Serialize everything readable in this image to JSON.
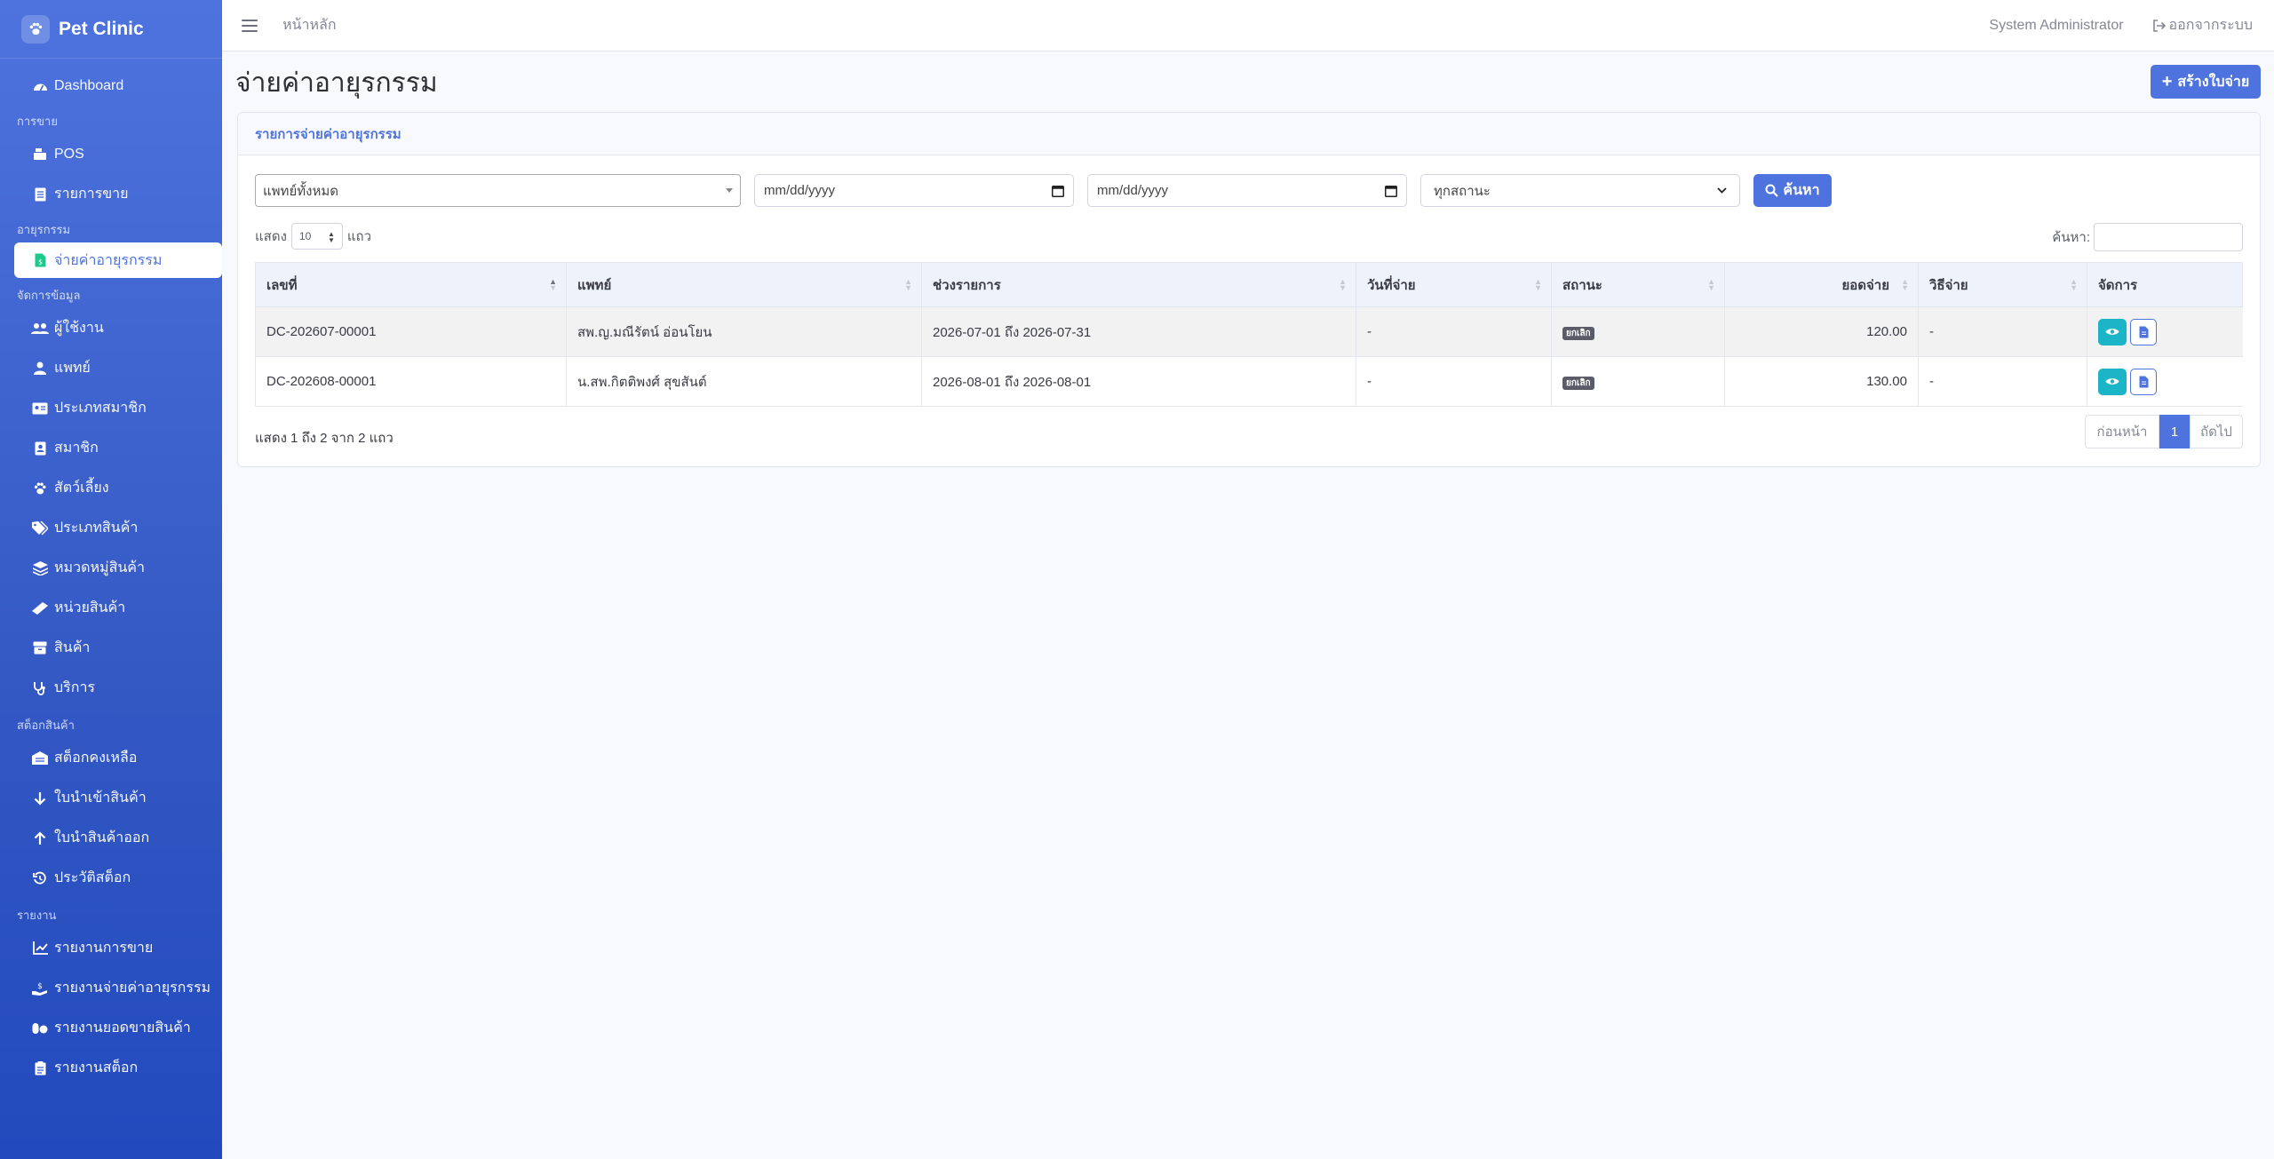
{
  "sidebar": {
    "brand": "Pet Clinic",
    "items": {
      "dashboard": "Dashboard",
      "sales_heading": "การขาย",
      "pos": "POS",
      "sales_list": "รายการขาย",
      "medicine_heading": "อายุรกรรม",
      "medicine_pay": "จ่ายค่าอายุรกรรม",
      "data_heading": "จัดการข้อมูล",
      "users": "ผู้ใช้งาน",
      "doctors": "แพทย์",
      "member_types": "ประเภทสมาชิก",
      "members": "สมาชิก",
      "pets": "สัตว์เลี้ยง",
      "product_types": "ประเภทสินค้า",
      "product_categories": "หมวดหมู่สินค้า",
      "product_units": "หน่วยสินค้า",
      "products": "สินค้า",
      "services": "บริการ",
      "stock_heading": "สต็อกสินค้า",
      "stock_balance": "สต็อกคงเหลือ",
      "stock_in": "ใบนำเข้าสินค้า",
      "stock_out": "ใบนำสินค้าออก",
      "stock_history": "ประวัติสต็อก",
      "report_heading": "รายงาน",
      "report_sales": "รายงานการขาย",
      "report_medicine_pay": "รายงานจ่ายค่าอายุรกรรม",
      "report_product_sales": "รายงานยอดขายสินค้า",
      "report_stock": "รายงานสต็อก"
    }
  },
  "topbar": {
    "home": "หน้าหลัก",
    "user": "System Administrator",
    "logout": "ออกจากระบบ"
  },
  "page": {
    "title": "จ่ายค่าอายุรกรรม",
    "create_button": "สร้างใบจ่าย"
  },
  "card": {
    "header": "รายการจ่ายค่าอายุรกรรม",
    "filters": {
      "doctor": "แพทย์ทั้งหมด",
      "date_from": "mm/dd/yyyy",
      "date_to": "mm/dd/yyyy",
      "status": "ทุกสถานะ",
      "search_button": "ค้นหา"
    },
    "length": {
      "prefix": "แสดง",
      "value": "10",
      "suffix": "แถว"
    },
    "search_label": "ค้นหา:",
    "columns": [
      "เลขที่",
      "แพทย์",
      "ช่วงรายการ",
      "วันที่จ่าย",
      "สถานะ",
      "ยอดจ่าย",
      "วิธีจ่าย",
      "จัดการ"
    ],
    "rows": [
      {
        "no": "DC-202607-00001",
        "doctor": "สพ.ญ.มณีรัตน์ อ่อนโยน",
        "period": "2026-07-01 ถึง 2026-07-31",
        "paid_date": "-",
        "status": "ยกเลิก",
        "amount": "120.00",
        "method": "-"
      },
      {
        "no": "DC-202608-00001",
        "doctor": "น.สพ.กิตติพงศ์ สุขสันต์",
        "period": "2026-08-01 ถึง 2026-08-01",
        "paid_date": "-",
        "status": "ยกเลิก",
        "amount": "130.00",
        "method": "-"
      }
    ],
    "info": "แสดง 1 ถึง 2 จาก 2 แถว",
    "pager": {
      "prev": "ก่อนหน้า",
      "current": "1",
      "next": "ถัดไป"
    }
  },
  "colors": {
    "primary": "#4e73df",
    "info": "#1cb5c7",
    "badge": "#5a5c69"
  }
}
